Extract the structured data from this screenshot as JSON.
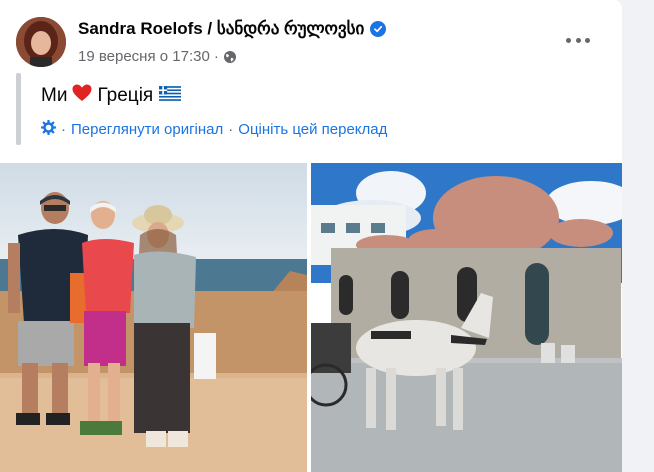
{
  "post": {
    "author": "Sandra Roelofs / სანდრა რულოვსი",
    "date": "19 вересня о 17:30",
    "dot": "·",
    "text_before": "Ми",
    "text_after": "Греція",
    "translate": {
      "see_original": "Переглянути оригінал",
      "rate_translation": "Оцініть цей переклад",
      "separator": "·"
    }
  },
  "icons": [
    "verified-badge-icon",
    "globe-icon",
    "more-options-icon",
    "heart-emoji-icon",
    "greek-flag-icon",
    "translate-gear-icon"
  ],
  "colors": {
    "link": "#1b74e4",
    "verified": "#1b74e4",
    "secondary_text": "#65676b",
    "heart": "#e02424"
  }
}
